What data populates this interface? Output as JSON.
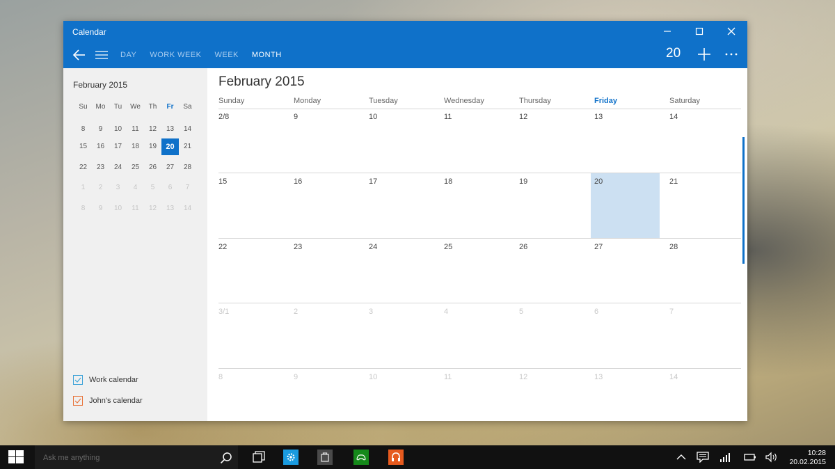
{
  "window": {
    "title": "Calendar",
    "view_tabs": [
      "DAY",
      "WORK WEEK",
      "WEEK",
      "MONTH"
    ],
    "active_view": "MONTH",
    "today_button": "20"
  },
  "sidebar": {
    "month_title": "February 2015",
    "weekdays": [
      "Su",
      "Mo",
      "Tu",
      "We",
      "Th",
      "Fr",
      "Sa"
    ],
    "weeks": [
      [
        "8",
        "9",
        "10",
        "11",
        "12",
        "13",
        "14"
      ],
      [
        "15",
        "16",
        "17",
        "18",
        "19",
        "20",
        "21"
      ],
      [
        "22",
        "23",
        "24",
        "25",
        "26",
        "27",
        "28"
      ],
      [
        "1",
        "2",
        "3",
        "4",
        "5",
        "6",
        "7"
      ],
      [
        "8",
        "9",
        "10",
        "11",
        "12",
        "13",
        "14"
      ]
    ],
    "selected_day": "20",
    "calendars": [
      {
        "label": "Work calendar",
        "color": "#3ea3d8"
      },
      {
        "label": "John's calendar",
        "color": "#e8743b"
      }
    ]
  },
  "main": {
    "month_title": "February 2015",
    "weekdays": [
      "Sunday",
      "Monday",
      "Tuesday",
      "Wednesday",
      "Thursday",
      "Friday",
      "Saturday"
    ],
    "today_weekday": "Friday",
    "weeks": [
      [
        "2/8",
        "9",
        "10",
        "11",
        "12",
        "13",
        "14"
      ],
      [
        "15",
        "16",
        "17",
        "18",
        "19",
        "20",
        "21"
      ],
      [
        "22",
        "23",
        "24",
        "25",
        "26",
        "27",
        "28"
      ],
      [
        "3/1",
        "2",
        "3",
        "4",
        "5",
        "6",
        "7"
      ],
      [
        "8",
        "9",
        "10",
        "11",
        "12",
        "13",
        "14"
      ]
    ],
    "today": "20"
  },
  "taskbar": {
    "search_placeholder": "Ask me anything",
    "time": "10:28",
    "date": "20.02.2015"
  },
  "colors": {
    "accent": "#0f71c9",
    "today_cell": "#cce0f2"
  }
}
